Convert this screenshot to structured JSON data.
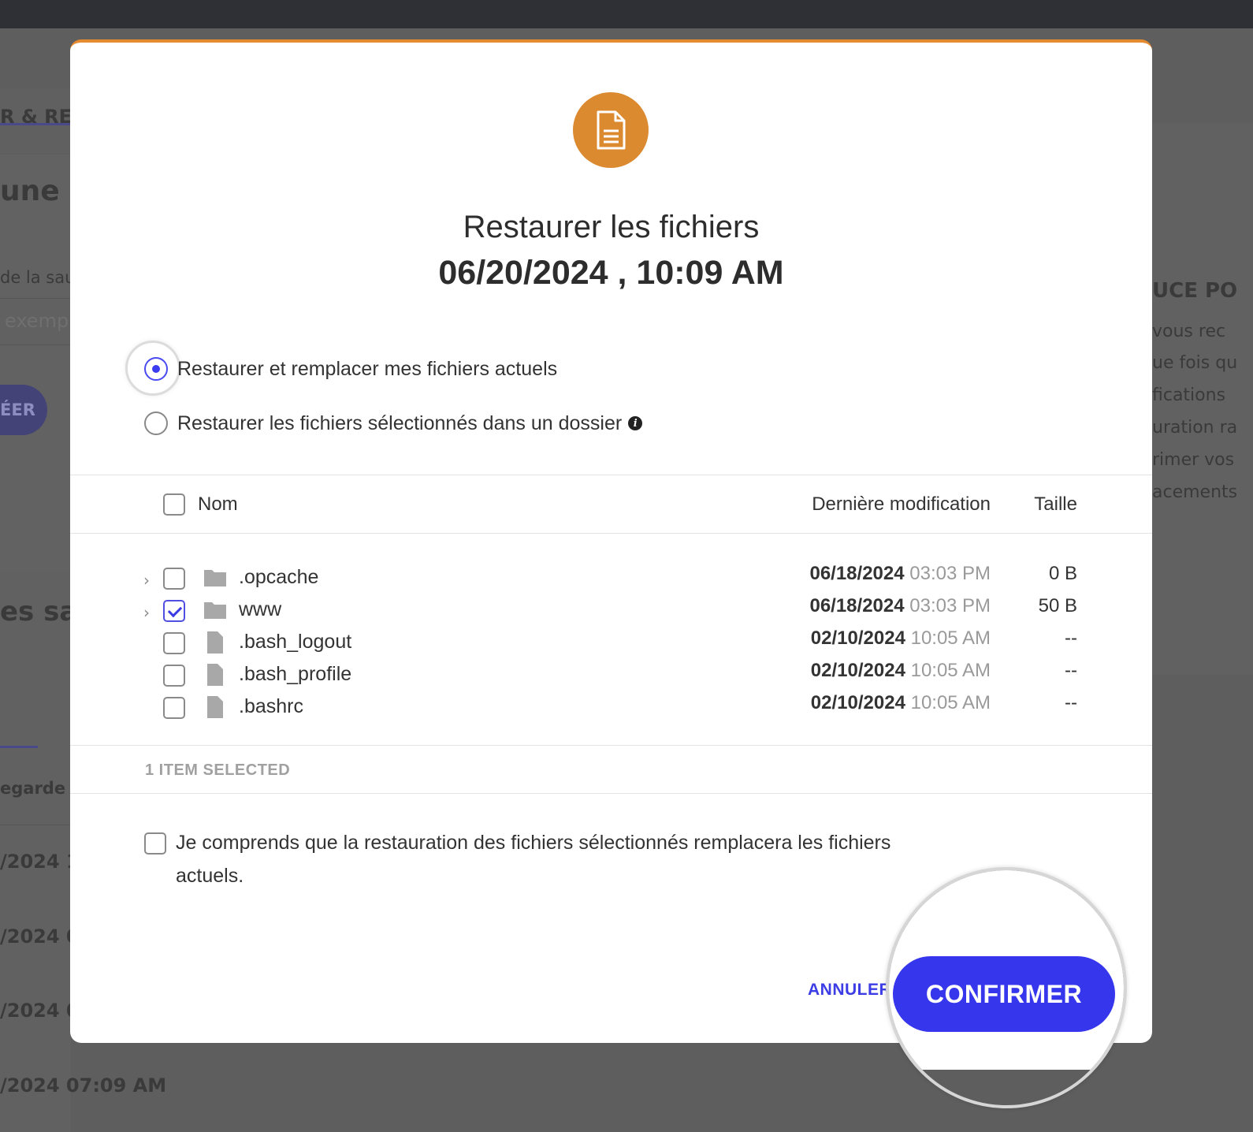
{
  "background": {
    "tab_label": "R & RES",
    "heading": "une n",
    "field_label": "de la sau",
    "field_placeholder": "exemp",
    "button_label": "ÉER",
    "list_heading": "es sa",
    "column_label": "egarde",
    "rows": [
      "/2024 1",
      "/2024 0",
      "/2024 0",
      "/2024 07:09 AM"
    ],
    "right_heading": "UCE PO",
    "right_lines": [
      "vous rec",
      "ue fois qu",
      "fications",
      "uration ra",
      "rimer vos",
      "acements"
    ]
  },
  "modal": {
    "icon": "document-icon",
    "accent_color": "#dc8a30",
    "title": "Restaurer les fichiers",
    "subtitle": "06/20/2024 , 10:09 AM",
    "options": [
      {
        "label": "Restaurer et remplacer mes fichiers actuels",
        "selected": true
      },
      {
        "label": "Restaurer les fichiers sélectionnés dans un dossier",
        "selected": false
      }
    ],
    "table": {
      "headers": {
        "name": "Nom",
        "modified": "Dernière modification",
        "size": "Taille"
      },
      "rows": [
        {
          "name": ".opcache",
          "type": "folder",
          "checked": false,
          "date": "06/18/2024",
          "time": "03:03 PM",
          "size": "0 B"
        },
        {
          "name": "www",
          "type": "folder",
          "checked": true,
          "date": "06/18/2024",
          "time": "03:03 PM",
          "size": "50 B"
        },
        {
          "name": ".bash_logout",
          "type": "file",
          "checked": false,
          "date": "02/10/2024",
          "time": "10:05 AM",
          "size": "--"
        },
        {
          "name": ".bash_profile",
          "type": "file",
          "checked": false,
          "date": "02/10/2024",
          "time": "10:05 AM",
          "size": "--"
        },
        {
          "name": ".bashrc",
          "type": "file",
          "checked": false,
          "date": "02/10/2024",
          "time": "10:05 AM",
          "size": "--"
        }
      ]
    },
    "selected_count": "1 ITEM SELECTED",
    "consent_line1": "Je comprends que la restauration des fichiers sélectionnés remplacera les fichiers",
    "consent_line2": "actuels.",
    "cancel_label": "ANNULER",
    "confirm_label": "CONFIRMER",
    "primary_color": "#3636ec"
  }
}
